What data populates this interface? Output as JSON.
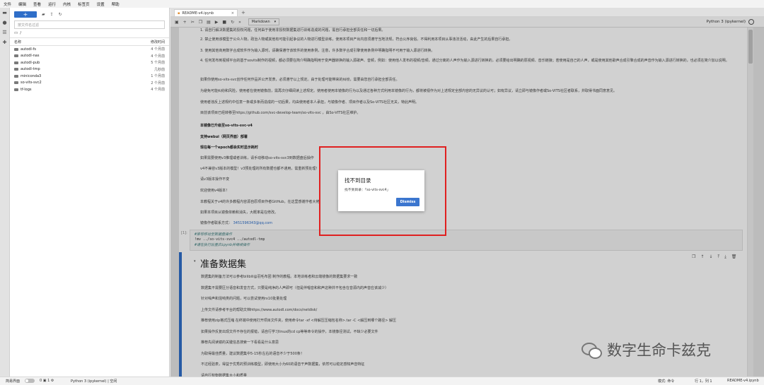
{
  "menu": [
    "文件",
    "编辑",
    "查看",
    "运行",
    "内核",
    "标签页",
    "设置",
    "帮助"
  ],
  "activity_icons": [
    "folder-icon",
    "running-icon",
    "commands-icon",
    "extensions-icon"
  ],
  "filebrowser": {
    "new_label": "+",
    "filter_placeholder": "按文件名过滤",
    "path": "/",
    "col_name": "名称",
    "col_modified": "修改时间",
    "files": [
      {
        "name": "autodl-fs",
        "modified": "4 个月前"
      },
      {
        "name": "autodl-nas",
        "modified": "4 个月前"
      },
      {
        "name": "autodl-pub",
        "modified": "5 个月前"
      },
      {
        "name": "autodl-tmp",
        "modified": "几秒前"
      },
      {
        "name": "miniconda3",
        "modified": "1 个月前"
      },
      {
        "name": "so-vits-svc2",
        "modified": "2 个月前"
      },
      {
        "name": "tf-logs",
        "modified": "4 个月前"
      }
    ]
  },
  "tab": {
    "title": "README-v4.ipynb",
    "close": "×",
    "add": "+"
  },
  "notebook_toolbar": {
    "cell_type": "Markdown",
    "kernel": "Python 3 (ipykernel)"
  },
  "doc_lines": [
    {
      "text": "1. 请自行解决数据集的授权问题，任何由于使用非授权数据集进行训练造成的问题，需自行承担全部责任和一切后果。",
      "bold": false
    },
    {
      "text": "2. 禁止使用该模型于公众人物，政治人物或其他有可能引起争议的人物进行模型训练，使用本项目产出内容须遵守当地法规，符合公序良俗。不得利用本项目从事违法活动，由此产生的后果自行承担。",
      "bold": false
    },
    {
      "text": "3. 使用其他商用数字合成软件作为输入源时，请确保遵守该软件的使用条例，注意，许多数字合成引擎使用条例中明确指明不可用于输入源进行转换。",
      "bold": false
    },
    {
      "text": "4. 任何发布到视频平台的基于sovits制作的视频，都必须要在简介明确指明用于变声器转换的输入源歌声、音频，例如：使用他人发布的视频/音频，通过分离的人声作为输入源进行转换的，必须要给出明确的原视频、音乐链接；若使用是自己的人声，或是使用其他歌声合成引擎合成的声音作为输入源进行转换的，也必须在简介加以说明。",
      "bold": false
    },
    {
      "text": "如果你使用so-vits-svc创作任何作品并公开发表，必须遵守以上规定。由于处理可能带来的纠纷，需要由您自行承担全部责任。",
      "bold": false
    },
    {
      "text": "为避免可能纠纷和风险，使用者在使用镜像前，需再次仔细阅读上述规定。使用者使用本镜像的行为以及通过各种方式利用本镜像的行为，都将被视作为对上述规定全部内容的无异议的认可；如有异议，请立即与镜像作者或So-VITS社区者联系，并取得书面同意意见。",
      "bold": false
    },
    {
      "text": "使用者违反上述规约中任意一条或多条而造成的一切后果，均由使用者本人承担，与镜像作者、项目作者以及So-VITS社区无关，特此声明。",
      "bold": false
    },
    {
      "text": "目前该项目已经转移至https://github.com/svc-develop-team/so-vits-svc ，由So-VITS社区维护。",
      "bold": false
    },
    {
      "text": "本镜像已升级至so-vits-svc-v4",
      "bold": true
    },
    {
      "text": "支持webui（网页界面）部署",
      "bold": true
    },
    {
      "text": "现在每一个epoch都会实时显示耗时",
      "bold": true
    },
    {
      "text": "如果需要使用v3推理或者训练，请手动移动so-vits-svc3到数据盘后操作",
      "bold": false
    },
    {
      "text": "v4不兼容v3版本的模型！v3预处理的所有数据也都不通用，需重新预处理！",
      "bold": false
    },
    {
      "text": "请v3版本操作不变",
      "bold": false
    },
    {
      "text": "欢迎使用v4版本！",
      "bold": false
    },
    {
      "text": "本教程关于v4的许多教程内容源自原项目作者GitHub，在这里感谢作者大佬",
      "bold": false
    },
    {
      "text": "如果本项目从镜像依赖和消失，大概率是在修改。",
      "bold": false
    },
    {
      "text": "镜像作者联系方式：",
      "link": "3451596343@qq.com",
      "bold": false
    }
  ],
  "code_cell": {
    "prompt": "[1]:",
    "lines": [
      {
        "text": "#推荐移动至数据盘操作",
        "comment": true
      },
      {
        "text": "!mv ../so-vits-svc4 ../autodl-tmp",
        "comment": false
      },
      {
        "text": "#请在执行后重启ipynb并继续操作",
        "comment": true
      }
    ]
  },
  "section": {
    "heading": "准备数据集",
    "lines": [
      "数据集的制备方法可以参考bilibili@羽毛布团 制作的教程。本地训练者和云端镜像的数据集要求一致",
      "数据集不需要区分语音和发音方式，只要是纯净的人声即可（但是伴唱音和和声这种并不包含在音源内的声音应该减少）",
      "针对噪声和混响类的问题，可以尝试使用rx10批量处理",
      "上传文件请参考平台的帮助文档https://www.autodl.com/docs/netdisk/",
      "推荐使用zip格式压缩 在终端中使用打开项目文件夹，使用命令tar -xf <待解压压缩包名称>.tar -C <解压到哪个路径> 解压",
      "如果操作反复出现文件不存在的报错，请自行学习linux的cd cp等等命令的操作，本镜像径测试，不缺少必要文件",
      "推荐先阅读镜的关键信息搜索一下看看是什么意思",
      "为取得最佳质量，建议数据集中5-15秒左右的语音不少于500条！",
      "不过经验表，得益于优秀的预训练模型，即使用大小为60的语音干声数据集，依然可以稳定感知声音特征",
      "请自行权衡数据集大小和质量"
    ]
  },
  "dialog": {
    "title": "找不到目录",
    "message": "找不到目录：「so-vits-svc4」",
    "dismiss": "Dismiss"
  },
  "statusbar": {
    "simple_label": "简易界面",
    "kernel_status": "Python 3 (ipykernel) | 空闲",
    "mode": "模式: 命令",
    "position": "行 1，列 1",
    "file": "README-v4.ipynb"
  },
  "watermark": {
    "text": "数字生命卡兹克"
  },
  "colors": {
    "accent": "#2f6ec8",
    "annotation_red": "#e02020"
  }
}
